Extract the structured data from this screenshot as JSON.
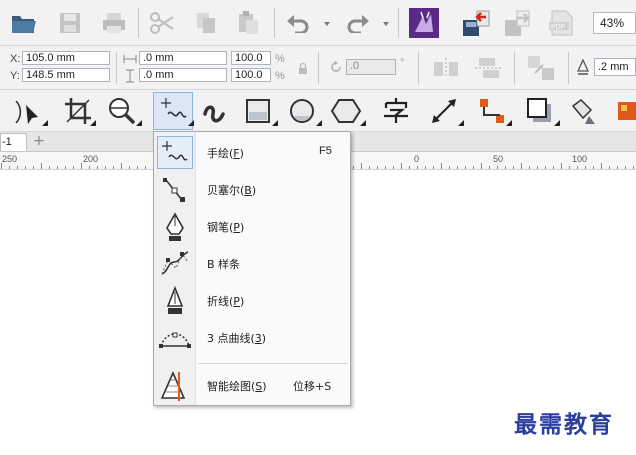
{
  "toolbar": {
    "zoom_value": "43%"
  },
  "property_bar": {
    "x_label": "X:",
    "x_value": "105.0 mm",
    "y_label": "Y:",
    "y_value": "148.5 mm",
    "width_value": ".0 mm",
    "height_value": ".0 mm",
    "scale_x": "100.0",
    "scale_y": "100.0",
    "percent_symbol": "%",
    "rotation_value": ".0",
    "degree_symbol": "°",
    "outline_value": ".2 mm"
  },
  "document_tab": {
    "label": "-1",
    "add_label": "+"
  },
  "ruler": {
    "labels": [
      "250",
      "200",
      "0",
      "50",
      "100"
    ]
  },
  "curve_menu": {
    "items": [
      {
        "label": "手绘(",
        "key": "F",
        "tail": ")",
        "shortcut": "F5",
        "icon": "freehand-icon"
      },
      {
        "label": "贝塞尔(",
        "key": "B",
        "tail": ")",
        "shortcut": "",
        "icon": "bezier-icon"
      },
      {
        "label": "钢笔(",
        "key": "P",
        "tail": ")",
        "shortcut": "",
        "icon": "pen-icon"
      },
      {
        "label": "B 样条",
        "key": "",
        "tail": "",
        "shortcut": "",
        "icon": "b-spline-icon"
      },
      {
        "label": "折线(",
        "key": "P",
        "tail": ")",
        "shortcut": "",
        "icon": "polyline-icon"
      },
      {
        "label": "3 点曲线(",
        "key": "3",
        "tail": ")",
        "shortcut": "",
        "icon": "3-point-curve-icon"
      },
      {
        "label": "智能绘图(",
        "key": "S",
        "tail": ")",
        "shortcut": "位移+S",
        "icon": "smart-drawing-icon"
      }
    ]
  },
  "watermark": "最需教育",
  "colors": {
    "toolbar_bg": "#f2f2f2",
    "menu_highlight": "#e4eef9",
    "watermark": "#2c3f9e",
    "accent_orange": "#e05a1a",
    "accent_purple": "#5b2a86"
  }
}
